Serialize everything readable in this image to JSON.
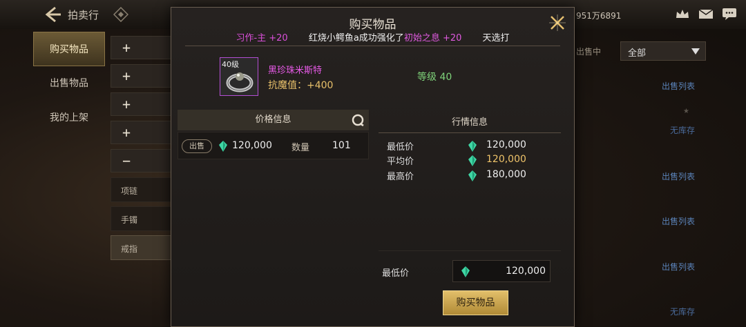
{
  "background": {
    "title": "拍卖行",
    "user_id": "951万6891",
    "sidebar": [
      "购买物品",
      "出售物品",
      "我的上架"
    ],
    "cat_buttons": [
      "+",
      "+",
      "+",
      "+",
      "−"
    ],
    "cat_subs": [
      "项链",
      "手镯",
      "戒指"
    ],
    "filter_label": "出售中",
    "filter_value": "全部",
    "sale_list": "出售列表",
    "no_stock": "无库存"
  },
  "modal": {
    "title": "购买物品",
    "ticker": {
      "seg1": "习作-主 +20",
      "seg2a": "红烧小鳄鱼a成功强化了",
      "seg2b": "初始之息 +20",
      "seg3": "天选打"
    },
    "item": {
      "level_badge": "40级",
      "name": "黑珍珠米斯特",
      "stat": "抗魔值：+400",
      "grade": "等级 40"
    },
    "price_info": {
      "heading": "价格信息",
      "sell_tag": "出售",
      "price": "120,000",
      "qty_label": "数量",
      "qty": "101"
    },
    "market_info": {
      "heading": "行情信息",
      "rows": [
        {
          "label": "最低价",
          "value": "120,000"
        },
        {
          "label": "平均价",
          "value": "120,000"
        },
        {
          "label": "最高价",
          "value": "180,000"
        }
      ]
    },
    "min_price": {
      "label": "最低价",
      "value": "120,000"
    },
    "buy_label": "购买物品"
  },
  "colors": {
    "accent_gold": "#e2bf6a",
    "item_purple": "#e85ae8",
    "grade_green": "#7fd37a",
    "gem_green": "#3fd6a4"
  }
}
